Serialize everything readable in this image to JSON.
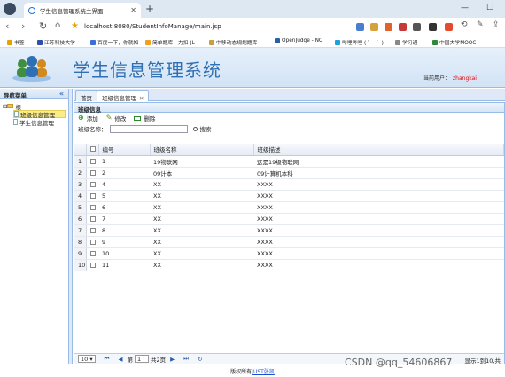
{
  "browser": {
    "tab_title": "学生信息管理系统主界面",
    "url": "localhost:8080/StudentInfoManage/main.jsp",
    "bookmarks": [
      "书签",
      "江苏科技大学",
      "百度一下，你就知",
      "简单题库 - 力扣 (L",
      "中移动态规划题库",
      "OpenJudge - NO",
      "哔哩哔哩 ( ゜- ゜)",
      "学习通",
      "中国大学MOOC"
    ]
  },
  "header": {
    "app_title": "学生信息管理系统",
    "user_label": "当前用户：",
    "user_name": "zhangkai"
  },
  "nav": {
    "title": "导航菜单",
    "root": "根",
    "items": [
      "班级信息管理",
      "学生信息管理"
    ]
  },
  "page_tabs": [
    "首页",
    "班级信息管理"
  ],
  "panel": {
    "title": "班级信息",
    "add": "添加",
    "edit": "修改",
    "delete": "删除",
    "search_label": "班级名称：",
    "search_value": "",
    "search_button": "搜索"
  },
  "grid": {
    "columns": [
      "编号",
      "班级名称",
      "班级描述"
    ],
    "rows": [
      {
        "n": "1",
        "id": "1",
        "name": "19物联网",
        "desc": "这是19级物联网"
      },
      {
        "n": "2",
        "id": "2",
        "name": "09计本",
        "desc": "09计算机本科"
      },
      {
        "n": "3",
        "id": "4",
        "name": "XX",
        "desc": "XXXX"
      },
      {
        "n": "4",
        "id": "5",
        "name": "XX",
        "desc": "XXXX"
      },
      {
        "n": "5",
        "id": "6",
        "name": "XX",
        "desc": "XXXX"
      },
      {
        "n": "6",
        "id": "7",
        "name": "XX",
        "desc": "XXXX"
      },
      {
        "n": "7",
        "id": "8",
        "name": "XX",
        "desc": "XXXX"
      },
      {
        "n": "8",
        "id": "9",
        "name": "XX",
        "desc": "XXXX"
      },
      {
        "n": "9",
        "id": "10",
        "name": "XX",
        "desc": "XXXX"
      },
      {
        "n": "10",
        "id": "11",
        "name": "XX",
        "desc": "XXXX"
      }
    ]
  },
  "pager": {
    "page_size": "10",
    "page_label": "第",
    "page_value": "1",
    "total_pages": "共2页",
    "info": "显示1到10,共"
  },
  "footer": {
    "prefix": "版权所有",
    "link": "JUST张凯"
  },
  "watermark": "CSDN @qq_54606867",
  "colors": {
    "accent": "#2f6fb3",
    "border": "#99bbe8",
    "user": "#e00000"
  }
}
